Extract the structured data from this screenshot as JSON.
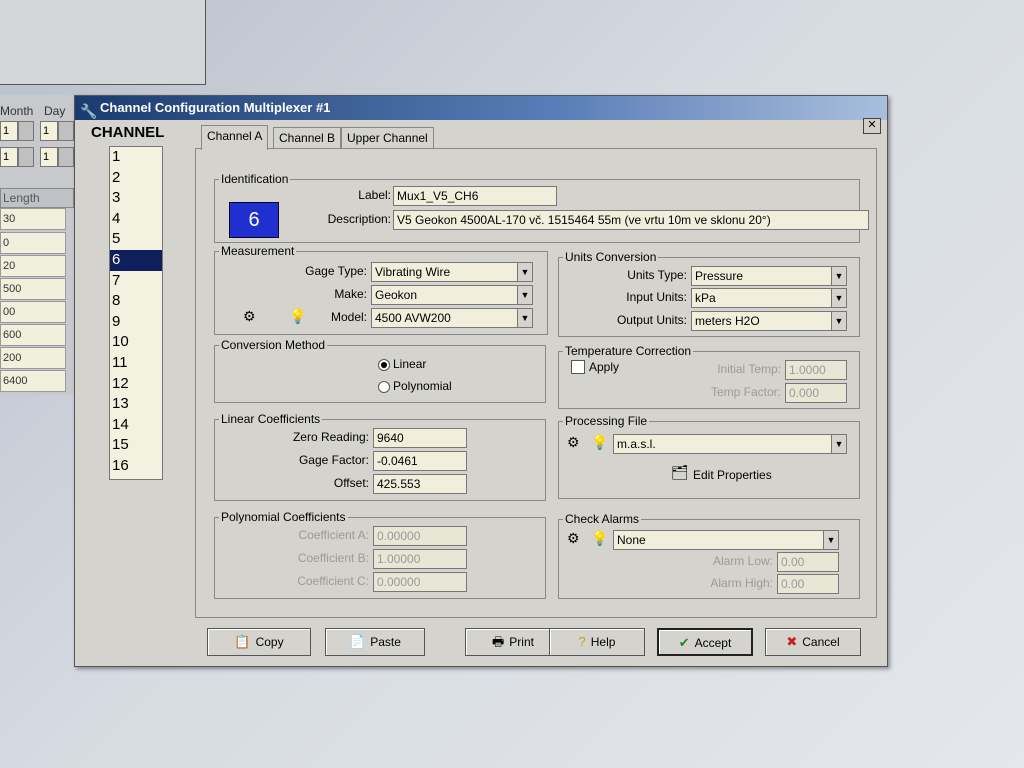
{
  "background": {
    "month_label": "Month",
    "day_label": "Day",
    "month_values": [
      "1",
      "1"
    ],
    "day_values": [
      "1",
      "1"
    ],
    "length_label": "Length",
    "lengths": [
      "30",
      "0",
      "20",
      "500",
      "00",
      "600",
      "200",
      "6400"
    ]
  },
  "dialog": {
    "title": "Channel Configuration Multiplexer #1",
    "close": "✕"
  },
  "channel": {
    "label": "CHANNEL",
    "items": [
      "1",
      "2",
      "3",
      "4",
      "5",
      "6",
      "7",
      "8",
      "9",
      "10",
      "11",
      "12",
      "13",
      "14",
      "15",
      "16"
    ],
    "selected": "6"
  },
  "tabs": [
    "Channel A",
    "Channel B",
    "Upper Channel"
  ],
  "identification": {
    "title": "Identification",
    "number": "6",
    "label_caption": "Label:",
    "label_value": "Mux1_V5_CH6",
    "description_caption": "Description:",
    "description_value": "V5 Geokon 4500AL-170 vč. 1515464 55m (ve vrtu 10m ve sklonu 20°)"
  },
  "measurement": {
    "title": "Measurement",
    "gage_type_caption": "Gage Type:",
    "gage_type_value": "Vibrating Wire",
    "make_caption": "Make:",
    "make_value": "Geokon",
    "model_caption": "Model:",
    "model_value": "4500 AVW200"
  },
  "units": {
    "title": "Units Conversion",
    "units_type_caption": "Units Type:",
    "units_type_value": "Pressure",
    "input_caption": "Input Units:",
    "input_value": "kPa",
    "output_caption": "Output Units:",
    "output_value": "meters H2O"
  },
  "conversion": {
    "title": "Conversion Method",
    "linear": "Linear",
    "polynomial": "Polynomial",
    "selected": "Linear"
  },
  "temperature": {
    "title": "Temperature Correction",
    "apply": "Apply",
    "initial_temp_caption": "Initial Temp:",
    "initial_temp_value": "1.0000",
    "temp_factor_caption": "Temp Factor:",
    "temp_factor_value": "0.000"
  },
  "linear": {
    "title": "Linear Coefficients",
    "zero_caption": "Zero Reading:",
    "zero_value": "9640",
    "gage_factor_caption": "Gage Factor:",
    "gage_factor_value": "-0.0461",
    "offset_caption": "Offset:",
    "offset_value": "425.553"
  },
  "processing": {
    "title": "Processing File",
    "file_value": "m.a.s.l.",
    "edit_properties": "Edit Properties"
  },
  "polynomial": {
    "title": "Polynomial Coefficients",
    "a_caption": "Coefficient A:",
    "a_value": "0.00000",
    "b_caption": "Coefficient B:",
    "b_value": "1.00000",
    "c_caption": "Coefficient C:",
    "c_value": "0.00000"
  },
  "alarms": {
    "title": "Check Alarms",
    "value": "None",
    "low_caption": "Alarm Low:",
    "low_value": "0.00",
    "high_caption": "Alarm High:",
    "high_value": "0.00"
  },
  "buttons": {
    "copy": "Copy",
    "paste": "Paste",
    "print": "Print",
    "help": "Help",
    "accept": "Accept",
    "cancel": "Cancel"
  }
}
